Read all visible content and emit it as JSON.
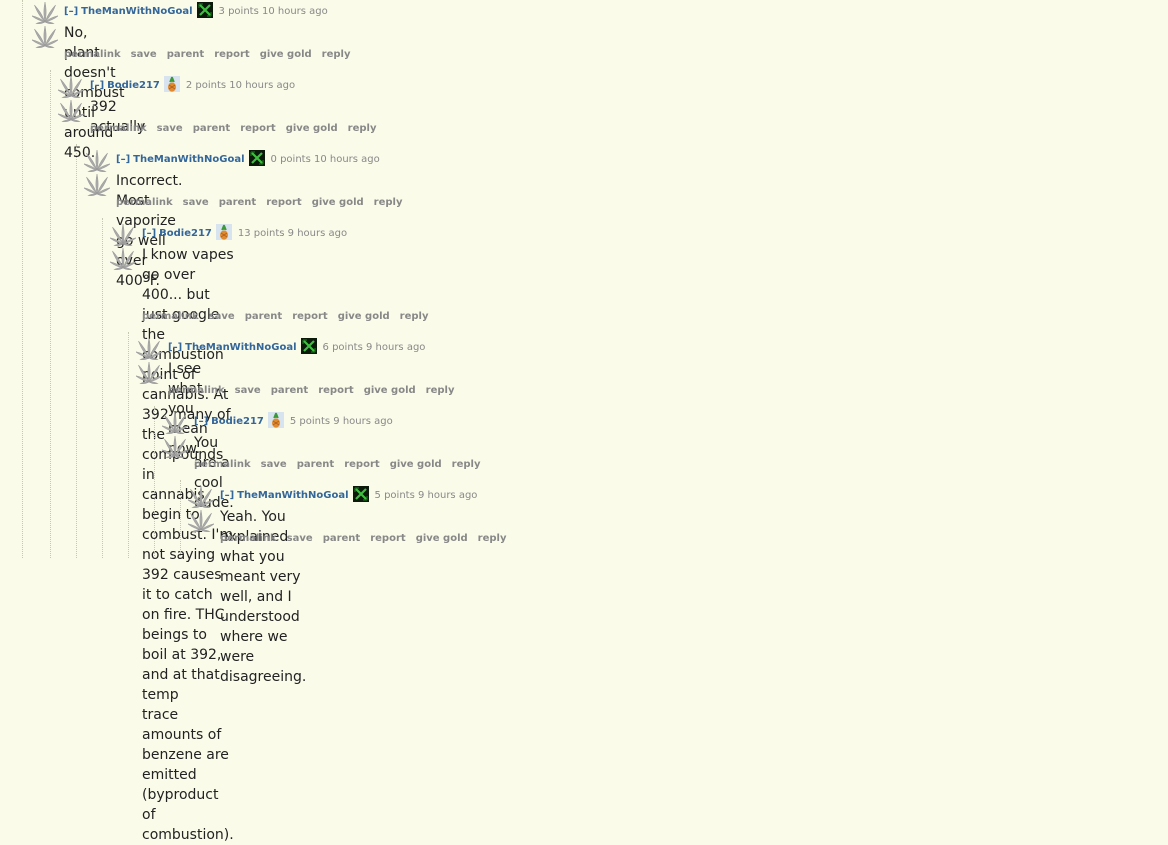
{
  "labels": {
    "toggle": "[–]",
    "permalink": "permalink",
    "save": "save",
    "parent": "parent",
    "report": "report",
    "give_gold": "give gold",
    "reply": "reply"
  },
  "comments": [
    {
      "author": "TheManWithNoGoal",
      "flair": "x-flair-icon",
      "score": "3 points 10 hours ago",
      "lines": [
        "No, plant doesn't combust until around 450."
      ]
    },
    {
      "author": "Bodie217",
      "flair": "pineapple-flair-icon",
      "score": "2 points 10 hours ago",
      "lines": [
        "392 actually"
      ]
    },
    {
      "author": "TheManWithNoGoal",
      "flair": "x-flair-icon",
      "score": "0 points 10 hours ago",
      "lines": [
        "Incorrect. Most vaporize go well over 400°F."
      ]
    },
    {
      "author": "Bodie217",
      "flair": "pineapple-flair-icon",
      "score": "13 points 9 hours ago",
      "lines": [
        "I know vapes go over 400... but just google the combustion point of cannabis. At 392 many of the compounds in",
        "cannabis begin to combust. I'm not saying 392 causes it to catch on fire. THC beings to boil at 392, and at that temp",
        "trace amounts of benzene are emitted (byproduct of combustion)."
      ]
    },
    {
      "author": "TheManWithNoGoal",
      "flair": "x-flair-icon",
      "score": "6 points 9 hours ago",
      "lines": [
        "I see what you mean now."
      ]
    },
    {
      "author": "Bodie217",
      "flair": "pineapple-flair-icon",
      "score": "5 points 9 hours ago",
      "lines": [
        "You are a cool dude."
      ]
    },
    {
      "author": "TheManWithNoGoal",
      "flair": "x-flair-icon",
      "score": "5 points 9 hours ago",
      "lines": [
        "Yeah. You explained what you meant very well, and I understood where we were disagreeing."
      ]
    }
  ]
}
